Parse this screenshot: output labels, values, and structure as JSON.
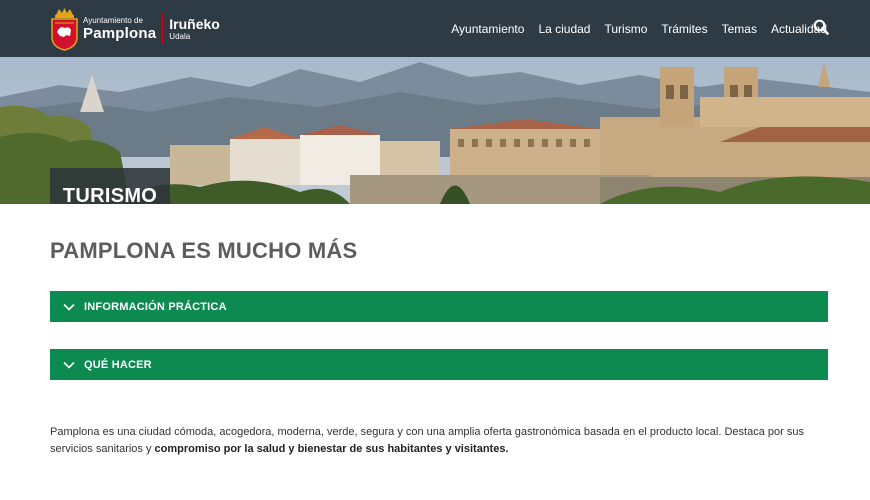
{
  "header": {
    "logo_small": "Ayuntamiento de",
    "logo_big": "Pamplona",
    "logo_eu_big": "Iruñeko",
    "logo_eu_small": "Udala",
    "nav": [
      "Ayuntamiento",
      "La ciudad",
      "Turismo",
      "Trámites",
      "Temas",
      "Actualidad"
    ]
  },
  "hero": {
    "title": "TURISMO"
  },
  "main": {
    "heading": "PAMPLONA ES MUCHO MÁS",
    "accordions": [
      "INFORMACIÓN PRÁCTICA",
      "QUÉ HACER"
    ],
    "intro_text": "Pamplona es una ciudad cómoda, acogedora, moderna, verde, segura y con una amplia oferta gastronómica basada en el producto local. Destaca por sus servicios sanitarios y ",
    "intro_bold": "compromiso por la salud y bienestar de sus habitantes y visitantes."
  },
  "colors": {
    "header_bg": "#2f3b44",
    "accent_green": "#0d8a4f",
    "heading_gray": "#5d5d5d"
  },
  "icons": [
    "shield-icon",
    "search-icon",
    "chevron-down-icon"
  ]
}
